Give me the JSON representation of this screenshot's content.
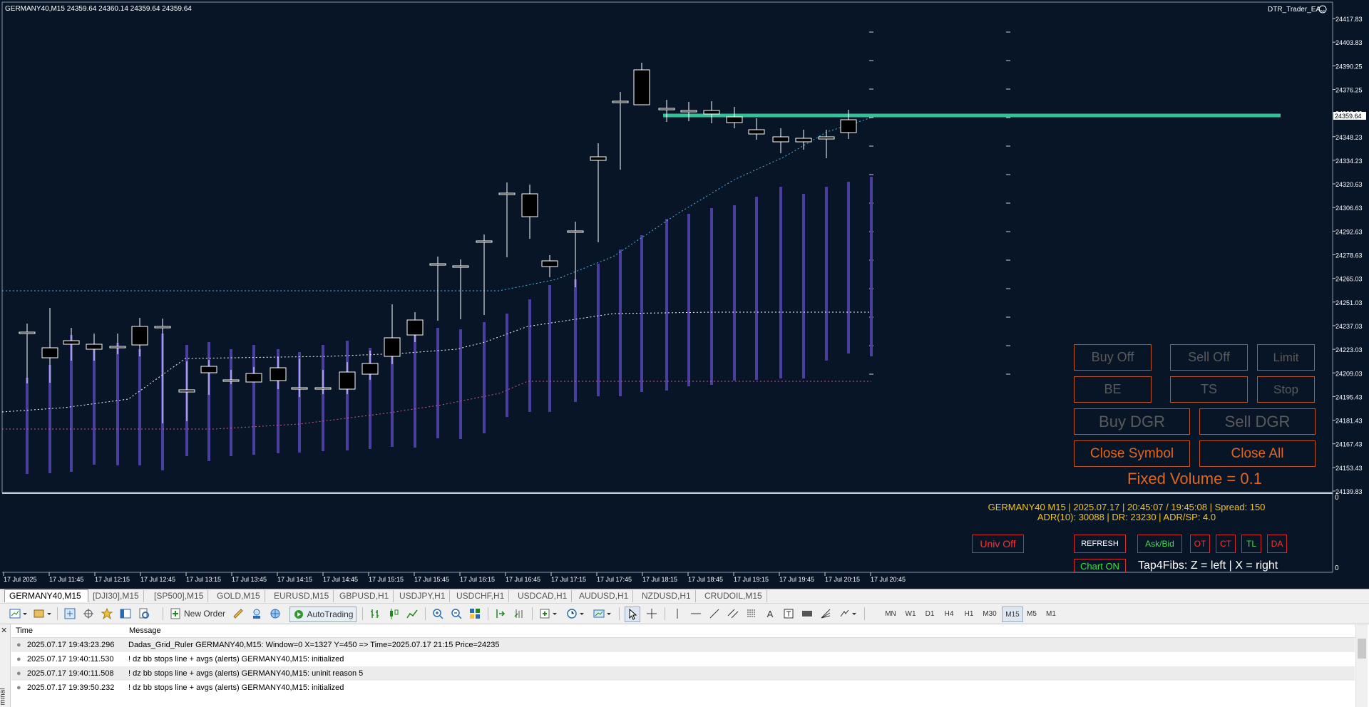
{
  "chart": {
    "header": "GERMANY40,M15  24359.64 24360.14 24359.64 24359.64",
    "ea_name": "DTR_Trader_EA",
    "price_labels": [
      "24417.83",
      "24403.83",
      "24390.25",
      "24376.25",
      "24362.23",
      "24348.23",
      "24334.23",
      "24320.63",
      "24306.63",
      "24292.63",
      "24278.63",
      "24265.03",
      "24251.03",
      "24237.03",
      "24223.03",
      "24209.03",
      "24195.43",
      "24181.43",
      "24167.43",
      "24153.43",
      "24139.83"
    ],
    "current_price": "24359.64",
    "sub_labels": [
      "0",
      "0"
    ],
    "time_labels": [
      "17 Jul 2025",
      "17 Jul 11:45",
      "17 Jul 12:15",
      "17 Jul 12:45",
      "17 Jul 13:15",
      "17 Jul 13:45",
      "17 Jul 14:15",
      "17 Jul 14:45",
      "17 Jul 15:15",
      "17 Jul 15:45",
      "17 Jul 16:15",
      "17 Jul 16:45",
      "17 Jul 17:15",
      "17 Jul 17:45",
      "17 Jul 18:15",
      "17 Jul 18:45",
      "17 Jul 19:15",
      "17 Jul 19:45",
      "17 Jul 20:15",
      "17 Jul 20:45"
    ],
    "colors": {
      "background": "#071527",
      "candle_body": "#000000",
      "candle_line": "#ffffff",
      "volume": "#4a3f9f",
      "accent": "#c0561a",
      "level_line": "#36d6a4"
    }
  },
  "panel": {
    "buy_off": "Buy Off",
    "sell_off": "Sell Off",
    "limit": "Limit",
    "be": "BE",
    "ts": "TS",
    "stop": "Stop",
    "buy_dgr": "Buy DGR",
    "sell_dgr": "Sell DGR",
    "close_symbol": "Close Symbol",
    "close_all": "Close All",
    "fixed_volume": "Fixed Volume = 0.1",
    "info_line1": "GERMANY40 M15 | 2025.07.17 | 20:45:07 / 19:45:08 | Spread: 150",
    "info_line2": "ADR(10): 30088 | DR: 23230 | ADR/SP: 4.0",
    "univ_off": "Univ Off",
    "refresh": "REFRESH",
    "ask_bid": "Ask/Bid",
    "ot": "OT",
    "ct": "CT",
    "tl": "TL",
    "da": "DA",
    "chart_on": "Chart ON",
    "tap4fibs": "Tap4Fibs: Z = left | X = right"
  },
  "tabs": [
    "GERMANY40,M15",
    "[DJI30],M15",
    "[SP500],M15",
    "GOLD,M15",
    "EURUSD,M15",
    "GBPUSD,H1",
    "USDJPY,H1",
    "USDCHF,H1",
    "USDCAD,H1",
    "AUDUSD,H1",
    "NZDUSD,H1",
    "CRUDOIL,M15"
  ],
  "toolbar": {
    "new_order": "New Order",
    "auto_trading": "AutoTrading",
    "timeframes": [
      "MN",
      "W1",
      "D1",
      "H4",
      "H1",
      "M30",
      "M15",
      "M5",
      "M1"
    ],
    "active_timeframe": "M15",
    "text_tool": "A"
  },
  "journal": {
    "col_time": "Time",
    "col_message": "Message",
    "side_label": "minal",
    "rows": [
      {
        "time": "2025.07.17 19:43:23.296",
        "message": "Dadas_Grid_Ruler GERMANY40,M15: Window=0 X=1327  Y=450  =>  Time=2025.07.17 21:15  Price=24235"
      },
      {
        "time": "2025.07.17 19:40:11.530",
        "message": "! dz bb stops line + avgs (alerts) GERMANY40,M15: initialized"
      },
      {
        "time": "2025.07.17 19:40:11.508",
        "message": "! dz bb stops line + avgs (alerts) GERMANY40,M15: uninit reason 5"
      },
      {
        "time": "2025.07.17 19:39:50.232",
        "message": "! dz bb stops line + avgs (alerts) GERMANY40,M15: initialized"
      }
    ]
  }
}
